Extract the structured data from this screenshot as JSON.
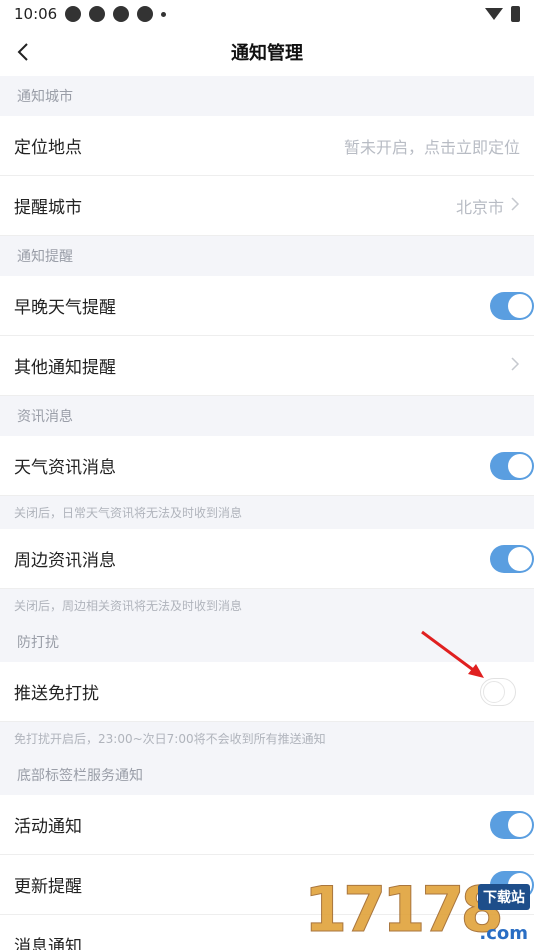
{
  "status_bar": {
    "time": "10:06"
  },
  "nav": {
    "title": "通知管理"
  },
  "sections": {
    "city": {
      "header": "通知城市",
      "location_label": "定位地点",
      "location_value": "暂未开启，点击立即定位",
      "remind_city_label": "提醒城市",
      "remind_city_value": "北京市"
    },
    "remind": {
      "header": "通知提醒",
      "morning_evening_label": "早晚天气提醒",
      "other_label": "其他通知提醒"
    },
    "news": {
      "header": "资讯消息",
      "weather_news_label": "天气资讯消息",
      "weather_news_hint": "关闭后，日常天气资讯将无法及时收到消息",
      "nearby_news_label": "周边资讯消息",
      "nearby_news_hint": "关闭后，周边相关资讯将无法及时收到消息"
    },
    "dnd": {
      "header": "防打扰",
      "push_dnd_label": "推送免打扰",
      "push_dnd_hint": "免打扰开启后，23:00~次日7:00将不会收到所有推送通知"
    },
    "tabbar": {
      "header": "底部标签栏服务通知",
      "activity_label": "活动通知",
      "update_label": "更新提醒",
      "message_label": "消息通知"
    }
  },
  "toggles": {
    "morning_evening": true,
    "weather_news": true,
    "nearby_news": true,
    "push_dnd": false,
    "activity": true,
    "update": true
  },
  "watermark": {
    "number": "17178",
    "badge": "下载站",
    "domain": ".com"
  },
  "colors": {
    "accent": "#5a9ee0",
    "arrow": "#e02020"
  }
}
